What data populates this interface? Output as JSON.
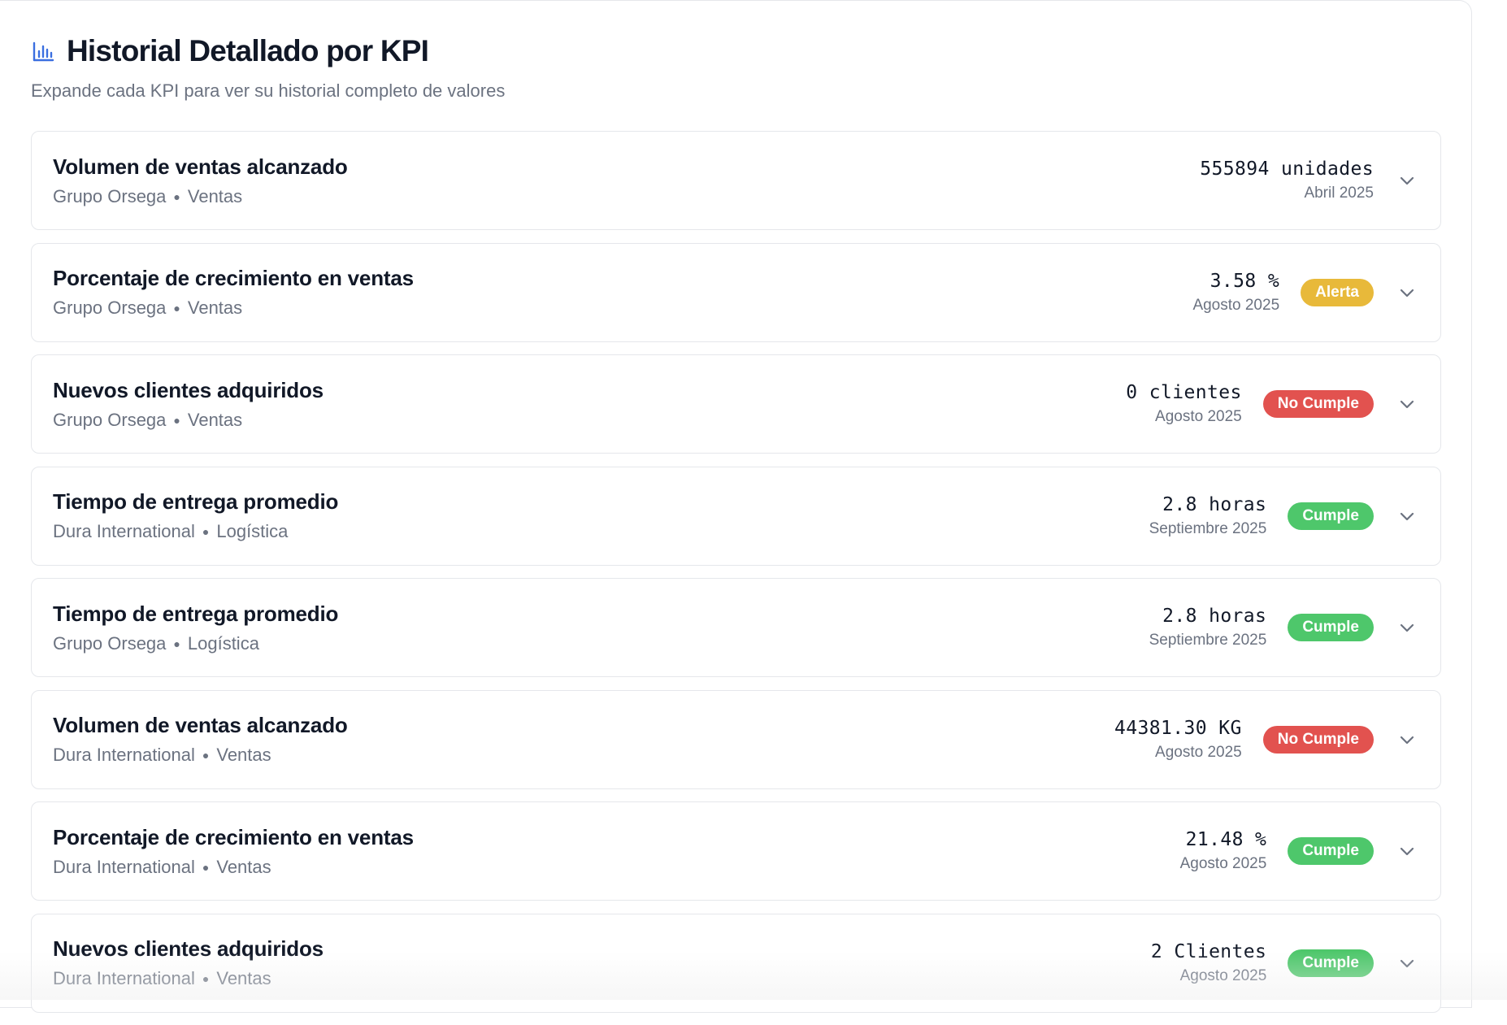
{
  "header": {
    "title": "Historial Detallado por KPI",
    "subtitle": "Expande cada KPI para ver su historial completo de valores",
    "icon": "bar-chart-icon"
  },
  "status_colors": {
    "Alerta": "#e8b93a",
    "No Cumple": "#e2524f",
    "Cumple": "#4ec76b"
  },
  "kpis": [
    {
      "name": "Volumen de ventas alcanzado",
      "company": "Grupo Orsega",
      "area": "Ventas",
      "value": "555894 unidades",
      "period": "Abril 2025",
      "status": ""
    },
    {
      "name": "Porcentaje de crecimiento en ventas",
      "company": "Grupo Orsega",
      "area": "Ventas",
      "value": "3.58 %",
      "period": "Agosto 2025",
      "status": "Alerta"
    },
    {
      "name": "Nuevos clientes adquiridos",
      "company": "Grupo Orsega",
      "area": "Ventas",
      "value": "0 clientes",
      "period": "Agosto 2025",
      "status": "No Cumple"
    },
    {
      "name": "Tiempo de entrega promedio",
      "company": "Dura International",
      "area": "Logística",
      "value": "2.8 horas",
      "period": "Septiembre 2025",
      "status": "Cumple"
    },
    {
      "name": "Tiempo de entrega promedio",
      "company": "Grupo Orsega",
      "area": "Logística",
      "value": "2.8 horas",
      "period": "Septiembre 2025",
      "status": "Cumple"
    },
    {
      "name": "Volumen de ventas alcanzado",
      "company": "Dura International",
      "area": "Ventas",
      "value": "44381.30 KG",
      "period": "Agosto 2025",
      "status": "No Cumple"
    },
    {
      "name": "Porcentaje de crecimiento en ventas",
      "company": "Dura International",
      "area": "Ventas",
      "value": "21.48 %",
      "period": "Agosto 2025",
      "status": "Cumple"
    },
    {
      "name": "Nuevos clientes adquiridos",
      "company": "Dura International",
      "area": "Ventas",
      "value": "2 Clientes",
      "period": "Agosto 2025",
      "status": "Cumple"
    }
  ]
}
